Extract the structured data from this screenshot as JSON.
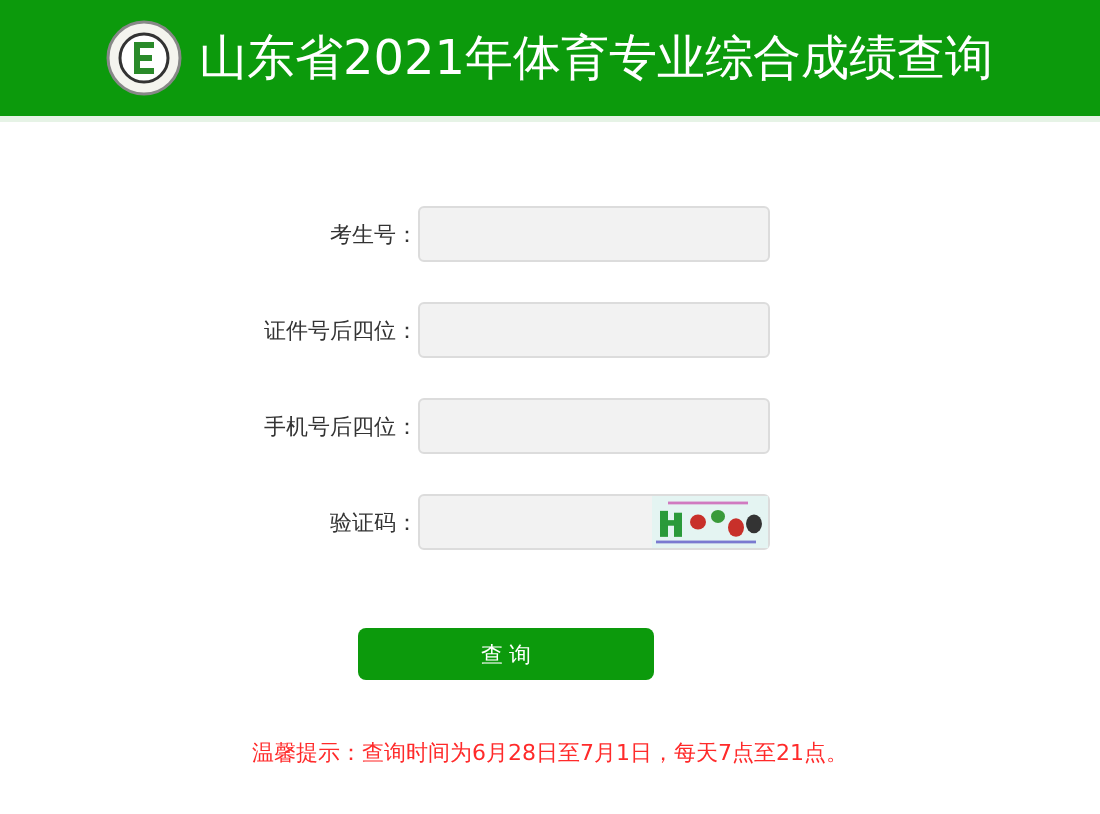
{
  "header": {
    "title": "山东省2021年体育专业综合成绩查询"
  },
  "fields": [
    {
      "label": "考生号：",
      "kind": "text"
    },
    {
      "label": "证件号后四位：",
      "kind": "text"
    },
    {
      "label": "手机号后四位：",
      "kind": "text"
    },
    {
      "label": "验证码：",
      "kind": "captcha"
    }
  ],
  "submit_button": "查 询",
  "notice": "温馨提示：查询时间为6月28日至7月1日，每天7点至21点。"
}
